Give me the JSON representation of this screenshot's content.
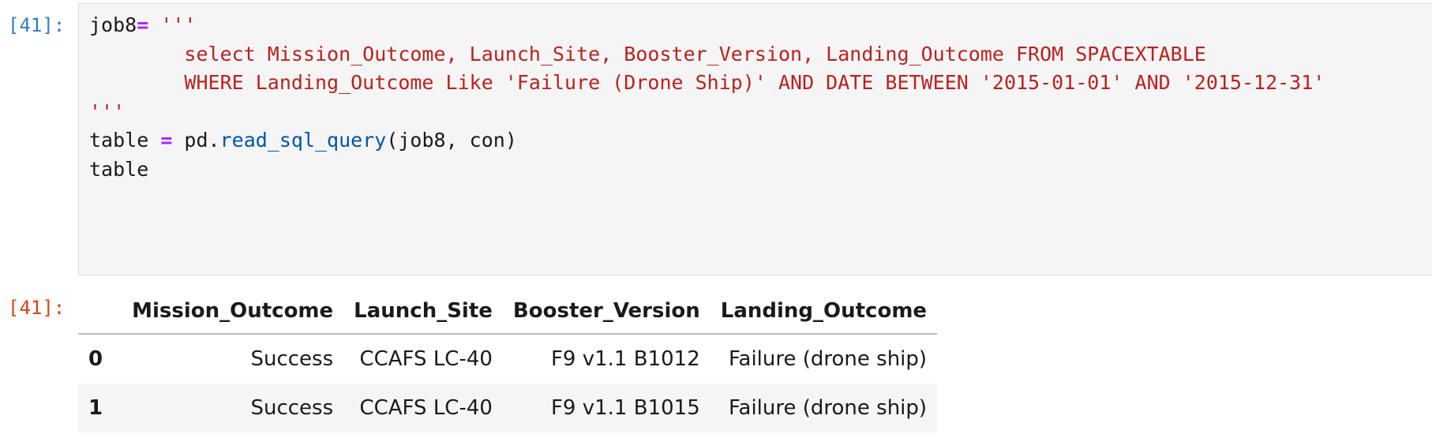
{
  "input_cell": {
    "prompt": "[41]:",
    "code": {
      "line1_var": "job8",
      "line1_op": "=",
      "line1_str": " '''",
      "line2": "        select Mission_Outcome, Launch_Site, Booster_Version, Landing_Outcome FROM SPACEXTABLE",
      "line3": "        WHERE Landing_Outcome Like 'Failure (Drone Ship)' AND DATE BETWEEN '2015-01-01' AND '2015-12-31'",
      "line4": "'''",
      "line5_var": "table ",
      "line5_op": "=",
      "line5_obj": " pd.",
      "line5_fn": "read_sql_query",
      "line5_args": "(job8, con)",
      "line6": "table"
    }
  },
  "output_cell": {
    "prompt": "[41]:",
    "table": {
      "columns": [
        "",
        "Mission_Outcome",
        "Launch_Site",
        "Booster_Version",
        "Landing_Outcome"
      ],
      "rows": [
        [
          "0",
          "Success",
          "CCAFS LC-40",
          "F9 v1.1 B1012",
          "Failure (drone ship)"
        ],
        [
          "1",
          "Success",
          "CCAFS LC-40",
          "F9 v1.1 B1015",
          "Failure (drone ship)"
        ]
      ]
    }
  }
}
